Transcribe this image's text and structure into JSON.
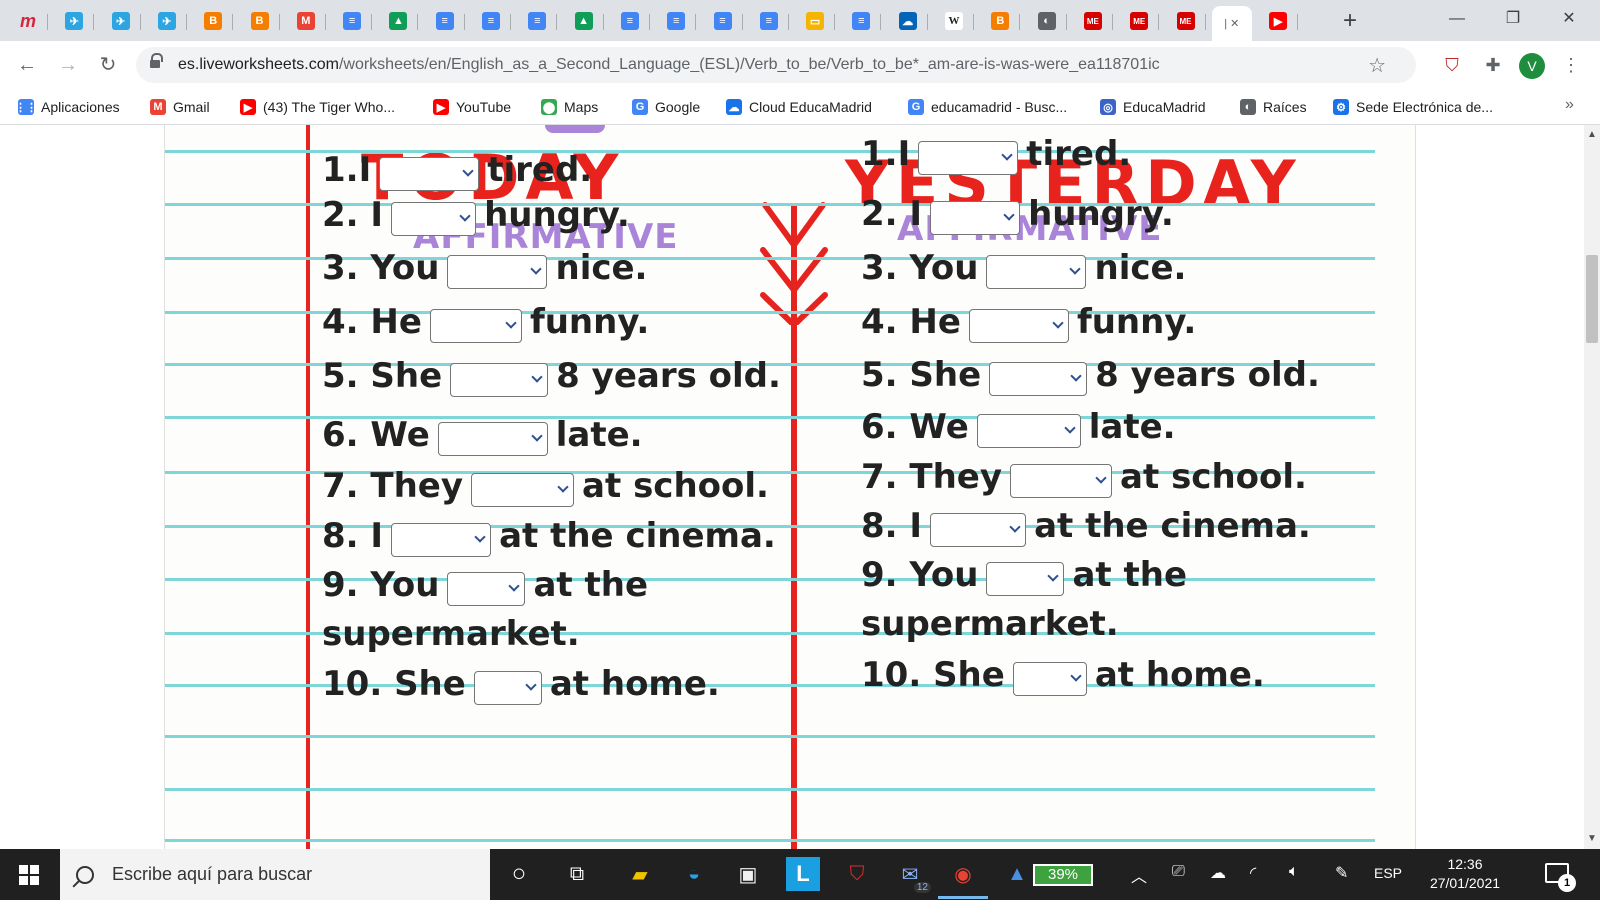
{
  "browser": {
    "tabs": [
      {
        "icon": "m-icon",
        "glyph": "m",
        "color": "#d7263d"
      },
      {
        "icon": "telegram-icon",
        "glyph": "✈",
        "color": "#2ca5e0"
      },
      {
        "icon": "telegram-icon",
        "glyph": "✈",
        "color": "#2ca5e0"
      },
      {
        "icon": "telegram-icon",
        "glyph": "✈",
        "color": "#2ca5e0"
      },
      {
        "icon": "blogger-icon",
        "glyph": "B",
        "color": "#f57d00"
      },
      {
        "icon": "blogger-icon",
        "glyph": "B",
        "color": "#f57d00"
      },
      {
        "icon": "gmail-icon",
        "glyph": "M",
        "color": "#ea4335"
      },
      {
        "icon": "docs-icon",
        "glyph": "≡",
        "color": "#4285f4"
      },
      {
        "icon": "drive-icon",
        "glyph": "▲",
        "color": "#0f9d58"
      },
      {
        "icon": "docs-icon",
        "glyph": "≡",
        "color": "#4285f4"
      },
      {
        "icon": "docs-icon",
        "glyph": "≡",
        "color": "#4285f4"
      },
      {
        "icon": "docs-icon",
        "glyph": "≡",
        "color": "#4285f4"
      },
      {
        "icon": "drive-icon",
        "glyph": "▲",
        "color": "#0f9d58"
      },
      {
        "icon": "docs-icon",
        "glyph": "≡",
        "color": "#4285f4"
      },
      {
        "icon": "docs-icon",
        "glyph": "≡",
        "color": "#4285f4"
      },
      {
        "icon": "docs-icon",
        "glyph": "≡",
        "color": "#4285f4"
      },
      {
        "icon": "docs-icon",
        "glyph": "≡",
        "color": "#4285f4"
      },
      {
        "icon": "slides-icon",
        "glyph": "▭",
        "color": "#f4b400"
      },
      {
        "icon": "docs-icon",
        "glyph": "≡",
        "color": "#4285f4"
      },
      {
        "icon": "onedrive-icon",
        "glyph": "☁",
        "color": "#0364b8"
      },
      {
        "icon": "wikipedia-icon",
        "glyph": "W",
        "color": "#555555"
      },
      {
        "icon": "blogger-icon",
        "glyph": "B",
        "color": "#f57d00"
      },
      {
        "icon": "globe-icon",
        "glyph": "◐",
        "color": "#5f6368"
      },
      {
        "icon": "me-icon",
        "glyph": "ME",
        "color": "#d50000"
      },
      {
        "icon": "me-icon",
        "glyph": "ME",
        "color": "#d50000"
      },
      {
        "icon": "me-icon",
        "glyph": "ME",
        "color": "#d50000"
      },
      {
        "icon": "active-tab",
        "glyph": "|",
        "color": "#ffffff"
      },
      {
        "icon": "youtube-icon",
        "glyph": "▶",
        "color": "#ff0000"
      }
    ],
    "url_host": "es.liveworksheets.com",
    "url_path": "/worksheets/en/English_as_a_Second_Language_(ESL)/Verb_to_be/Verb_to_be*_am-are-is-was-were_ea118701ic",
    "avatar_letter": "V",
    "bookmarks": [
      {
        "label": "Aplicaciones",
        "icon": "apps-grid-icon",
        "glyph": "⋮⋮",
        "color": "#4285f4"
      },
      {
        "label": "Gmail",
        "icon": "gmail-icon",
        "glyph": "M",
        "color": "#ea4335"
      },
      {
        "label": "(43) The Tiger Who...",
        "icon": "youtube-icon",
        "glyph": "▶",
        "color": "#ff0000"
      },
      {
        "label": "YouTube",
        "icon": "youtube-icon",
        "glyph": "▶",
        "color": "#ff0000"
      },
      {
        "label": "Maps",
        "icon": "maps-pin-icon",
        "glyph": "⬤",
        "color": "#34a853"
      },
      {
        "label": "Google",
        "icon": "google-icon",
        "glyph": "G",
        "color": "#4285f4"
      },
      {
        "label": "Cloud EducaMadrid",
        "icon": "cloud-icon",
        "glyph": "☁",
        "color": "#1a73e8"
      },
      {
        "label": "educamadrid - Busc...",
        "icon": "google-icon",
        "glyph": "G",
        "color": "#4285f4"
      },
      {
        "label": "EducaMadrid",
        "icon": "educamadrid-icon",
        "glyph": "◎",
        "color": "#3c63c7"
      },
      {
        "label": "Raíces",
        "icon": "globe-icon",
        "glyph": "◐",
        "color": "#5f6368"
      },
      {
        "label": "Sede Electrónica de...",
        "icon": "sede-icon",
        "glyph": "⚙",
        "color": "#1a73e8"
      }
    ],
    "bookmarks_more": "»"
  },
  "worksheet": {
    "today": {
      "title": "TODAY",
      "subtitle": "AFFIRMATIVE",
      "sentences": [
        {
          "pre": "1.I",
          "post": "tired."
        },
        {
          "pre": "2. I",
          "post": "hungry."
        },
        {
          "pre": "3. You",
          "post": "nice."
        },
        {
          "pre": "4. He",
          "post": "funny."
        },
        {
          "pre": "5. She",
          "post": "8 years old."
        },
        {
          "pre": "6. We",
          "post": "late."
        },
        {
          "pre": "7. They",
          "post": "at school."
        },
        {
          "pre": "8. I",
          "post": "at the cinema."
        },
        {
          "pre": "9. You",
          "post": "at the"
        },
        {
          "pre": "supermarket.",
          "post": ""
        },
        {
          "pre": "10. She",
          "post": "at home."
        }
      ]
    },
    "yesterday": {
      "title": "YESTERDAY",
      "subtitle": "AFFIRMATIVE",
      "sentences": [
        {
          "pre": "1.I",
          "post": "tired."
        },
        {
          "pre": "2. I",
          "post": "hungry."
        },
        {
          "pre": "3. You",
          "post": "nice."
        },
        {
          "pre": "4. He",
          "post": "funny."
        },
        {
          "pre": "5. She",
          "post": "8 years old."
        },
        {
          "pre": "6. We",
          "post": "late."
        },
        {
          "pre": "7. They",
          "post": "at school."
        },
        {
          "pre": "8. I",
          "post": "at the cinema."
        },
        {
          "pre": "9. You",
          "post": "at the"
        },
        {
          "pre": "supermarket.",
          "post": ""
        },
        {
          "pre": "10. She",
          "post": "at home."
        }
      ]
    },
    "dropdown_value": ""
  },
  "taskbar": {
    "search_placeholder": "Escribe aquí para buscar",
    "mail_badge": "12",
    "battery": "39%",
    "language": "ESP",
    "time": "12:36",
    "date": "27/01/2021",
    "notification_count": "1"
  },
  "colors": {
    "title_red": "#e8221d",
    "subtitle_purple": "#a984d9",
    "ruled_line": "#7ed6d9"
  }
}
